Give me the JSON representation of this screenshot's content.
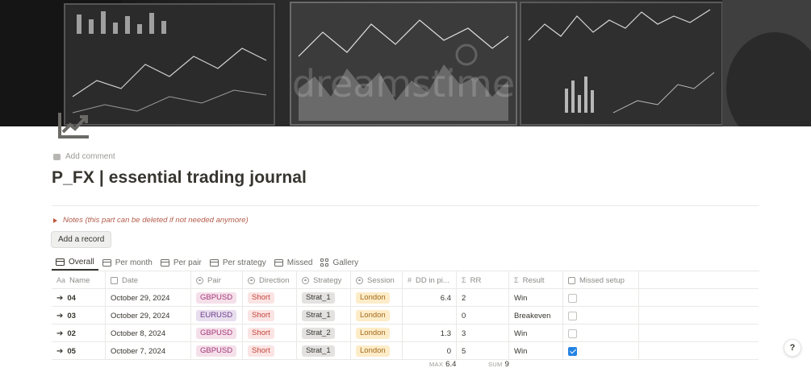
{
  "cover": {
    "watermark": "dreamstime"
  },
  "page": {
    "icon": "chart-trend-icon",
    "add_comment": "Add comment",
    "title": "P_FX | essential trading journal",
    "notes_toggle": "Notes (this part can be deleted if not needed anymore)",
    "add_record": "Add a record"
  },
  "tabs": [
    {
      "label": "Overall",
      "icon": "table-icon",
      "active": true
    },
    {
      "label": "Per month",
      "icon": "table-icon"
    },
    {
      "label": "Per pair",
      "icon": "table-icon"
    },
    {
      "label": "Per strategy",
      "icon": "table-icon"
    },
    {
      "label": "Missed",
      "icon": "table-icon"
    },
    {
      "label": "Gallery",
      "icon": "gallery-icon"
    }
  ],
  "columns": [
    {
      "label": "Name",
      "icon": "Aa"
    },
    {
      "label": "Date",
      "icon": "calendar-icon"
    },
    {
      "label": "Pair",
      "icon": "select-icon"
    },
    {
      "label": "Direction",
      "icon": "select-icon"
    },
    {
      "label": "Strategy",
      "icon": "select-icon"
    },
    {
      "label": "Session",
      "icon": "select-icon"
    },
    {
      "label": "DD in pi...",
      "icon": "#"
    },
    {
      "label": "RR",
      "icon": "Σ"
    },
    {
      "label": "Result",
      "icon": "Σ"
    },
    {
      "label": "Missed setup",
      "icon": "checkbox-icon"
    }
  ],
  "rows": [
    {
      "name": "04",
      "date": "October 29, 2024",
      "pair": "GBPUSD",
      "direction": "Short",
      "strategy": "Strat_1",
      "session": "London",
      "dd": "6.4",
      "rr": "2",
      "result": "Win",
      "missed": false
    },
    {
      "name": "03",
      "date": "October 29, 2024",
      "pair": "EURUSD",
      "direction": "Short",
      "strategy": "Strat_1",
      "session": "London",
      "dd": "",
      "rr": "0",
      "result": "Breakeven",
      "missed": false
    },
    {
      "name": "02",
      "date": "October 8, 2024",
      "pair": "GBPUSD",
      "direction": "Short",
      "strategy": "Strat_2",
      "session": "London",
      "dd": "1.3",
      "rr": "3",
      "result": "Win",
      "missed": false
    },
    {
      "name": "05",
      "date": "October 7, 2024",
      "pair": "GBPUSD",
      "direction": "Short",
      "strategy": "Strat_1",
      "session": "London",
      "dd": "0",
      "rr": "5",
      "result": "Win",
      "missed": true
    }
  ],
  "footer": {
    "max_label": "MAX",
    "max_value": "6.4",
    "sum_label": "SUM",
    "sum_value": "9"
  },
  "help_button": "?",
  "tag_colors": {
    "GBPUSD": {
      "bg": "#f5e0e9",
      "fg": "#a3387a"
    },
    "EURUSD": {
      "bg": "#e8deee",
      "fg": "#6a3c8a"
    },
    "Short": {
      "bg": "#fbe4e4",
      "fg": "#c4463a"
    },
    "Strat_1": {
      "bg": "#e3e2e0",
      "fg": "#37352f"
    },
    "Strat_2": {
      "bg": "#e3e2e0",
      "fg": "#37352f"
    },
    "London": {
      "bg": "#fdecc8",
      "fg": "#a46a1c"
    }
  }
}
